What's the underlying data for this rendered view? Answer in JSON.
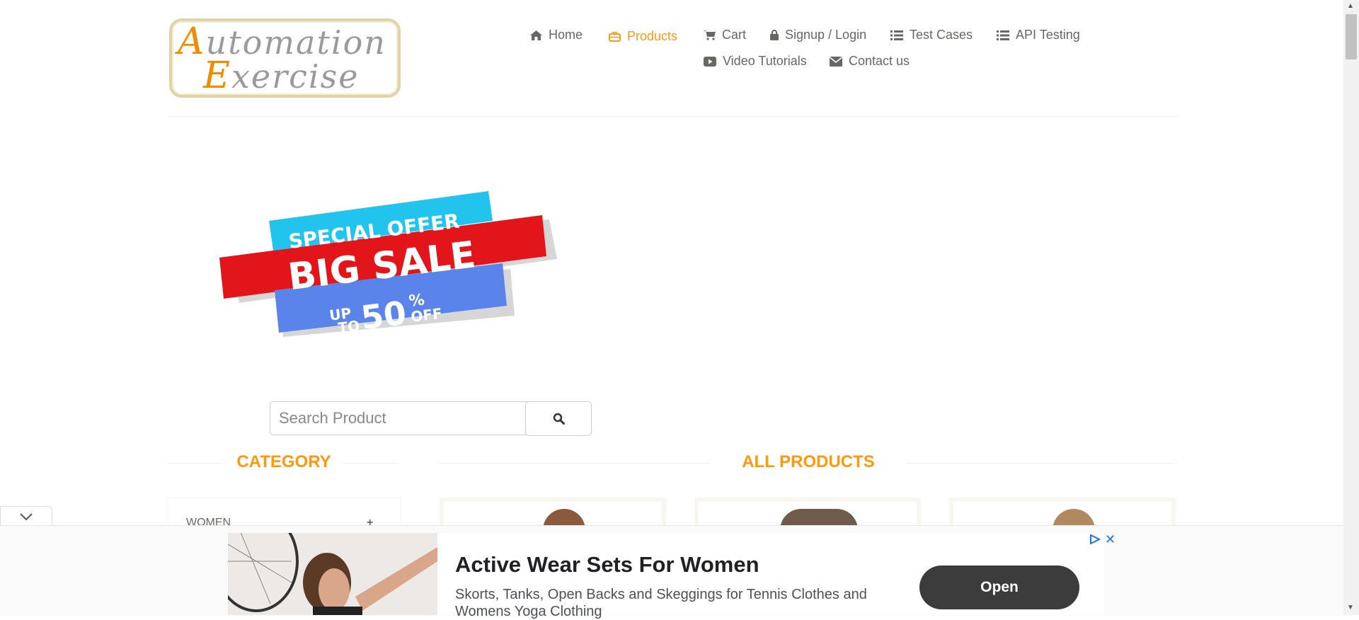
{
  "logo": {
    "line1_first": "A",
    "line1_rest": "utomation",
    "line2_first": "E",
    "line2_rest": "xercise"
  },
  "nav": {
    "home": "Home",
    "products": "Products",
    "cart": "Cart",
    "signup_login": "Signup / Login",
    "test_cases": "Test Cases",
    "api_testing": "API Testing",
    "video_tutorials": "Video Tutorials",
    "contact_us": "Contact us"
  },
  "banner": {
    "line1": "SPECIAL OFFER",
    "line2": "BIG SALE",
    "up": "UP",
    "to": "TO",
    "percent": "50",
    "pct_sign": "%",
    "off": "OFF"
  },
  "search": {
    "placeholder": "Search Product",
    "icon": "search-icon"
  },
  "sections": {
    "category": "CATEGORY",
    "all_products": "ALL PRODUCTS"
  },
  "category": {
    "items": [
      {
        "label": "WOMEN",
        "toggle": "+"
      }
    ]
  },
  "ad": {
    "title": "Active Wear Sets For Women",
    "description": "Skorts, Tanks, Open Backs and Skeggings for Tennis Clothes and Womens Yoga Clothing",
    "cta": "Open",
    "close": "✕"
  },
  "colors": {
    "accent": "#fe980f",
    "text": "#696763",
    "ad_button": "#3c3c3c",
    "banner_red": "#e2161a",
    "banner_cyan": "#22c4ee",
    "banner_blue": "#5b84ea"
  }
}
